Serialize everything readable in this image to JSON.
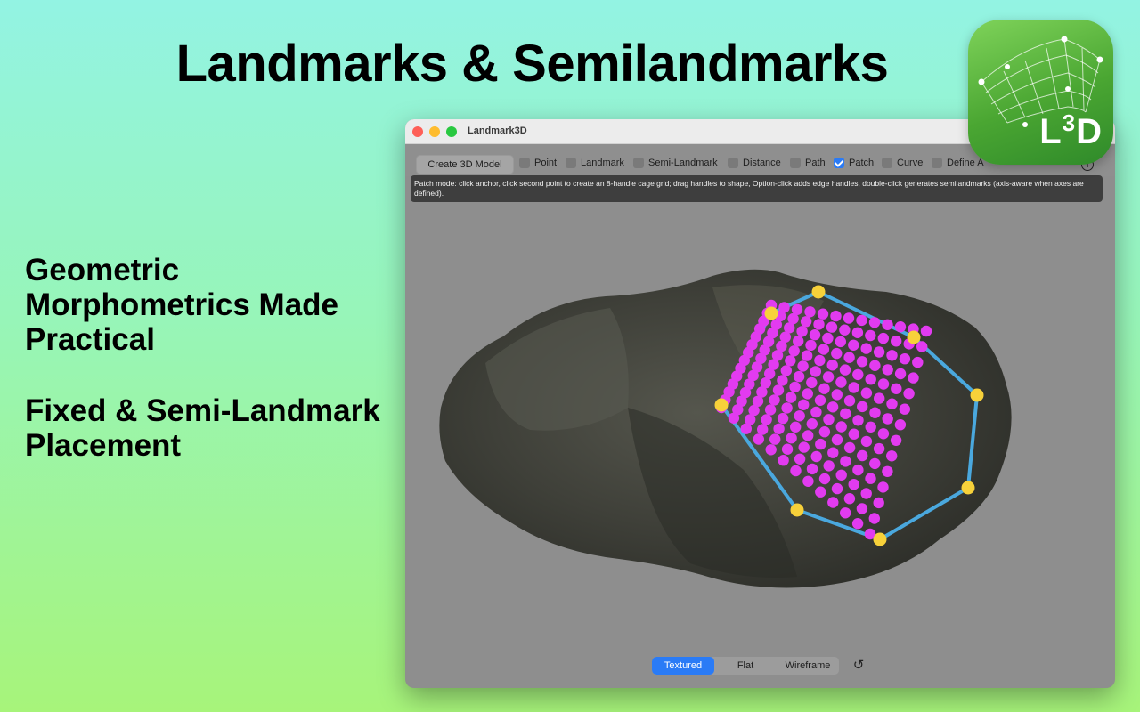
{
  "promo": {
    "headline": "Landmarks & Semilandmarks",
    "tagline_1": "Geometric Morphometrics Made Practical",
    "tagline_2": "Fixed & Semi-Landmark Placement"
  },
  "app_icon": {
    "label_main": "L",
    "label_sup": "3",
    "label_tail": "D",
    "icon": "mesh-surface-icon"
  },
  "window": {
    "title": "Landmark3D",
    "traffic_lights": [
      "close",
      "minimize",
      "zoom"
    ]
  },
  "toolbar": {
    "create_button": "Create 3D Model",
    "options": [
      {
        "label": "Point",
        "checked": false
      },
      {
        "label": "Landmark",
        "checked": false
      },
      {
        "label": "Semi-Landmark",
        "checked": false
      },
      {
        "label": "Distance",
        "checked": false
      },
      {
        "label": "Path",
        "checked": false
      },
      {
        "label": "Patch",
        "checked": true
      },
      {
        "label": "Curve",
        "checked": false
      },
      {
        "label": "Define A",
        "checked": false
      }
    ],
    "info_icon": "info-icon"
  },
  "hint": {
    "text": "Patch mode: click anchor, click second point to create an 8-handle cage grid; drag handles to shape, Option-click adds edge handles, double-click generates semilandmarks (axis-aware when axes are defined)."
  },
  "view_modes": {
    "options": [
      "Textured",
      "Flat",
      "Wireframe"
    ],
    "selected": "Textured"
  },
  "reset_icon": "reset-view-icon",
  "colors": {
    "semilandmark": "#e23bf0",
    "handle": "#f7d13a",
    "cage_edge": "#4aa8de",
    "accent": "#2a7bf6"
  }
}
